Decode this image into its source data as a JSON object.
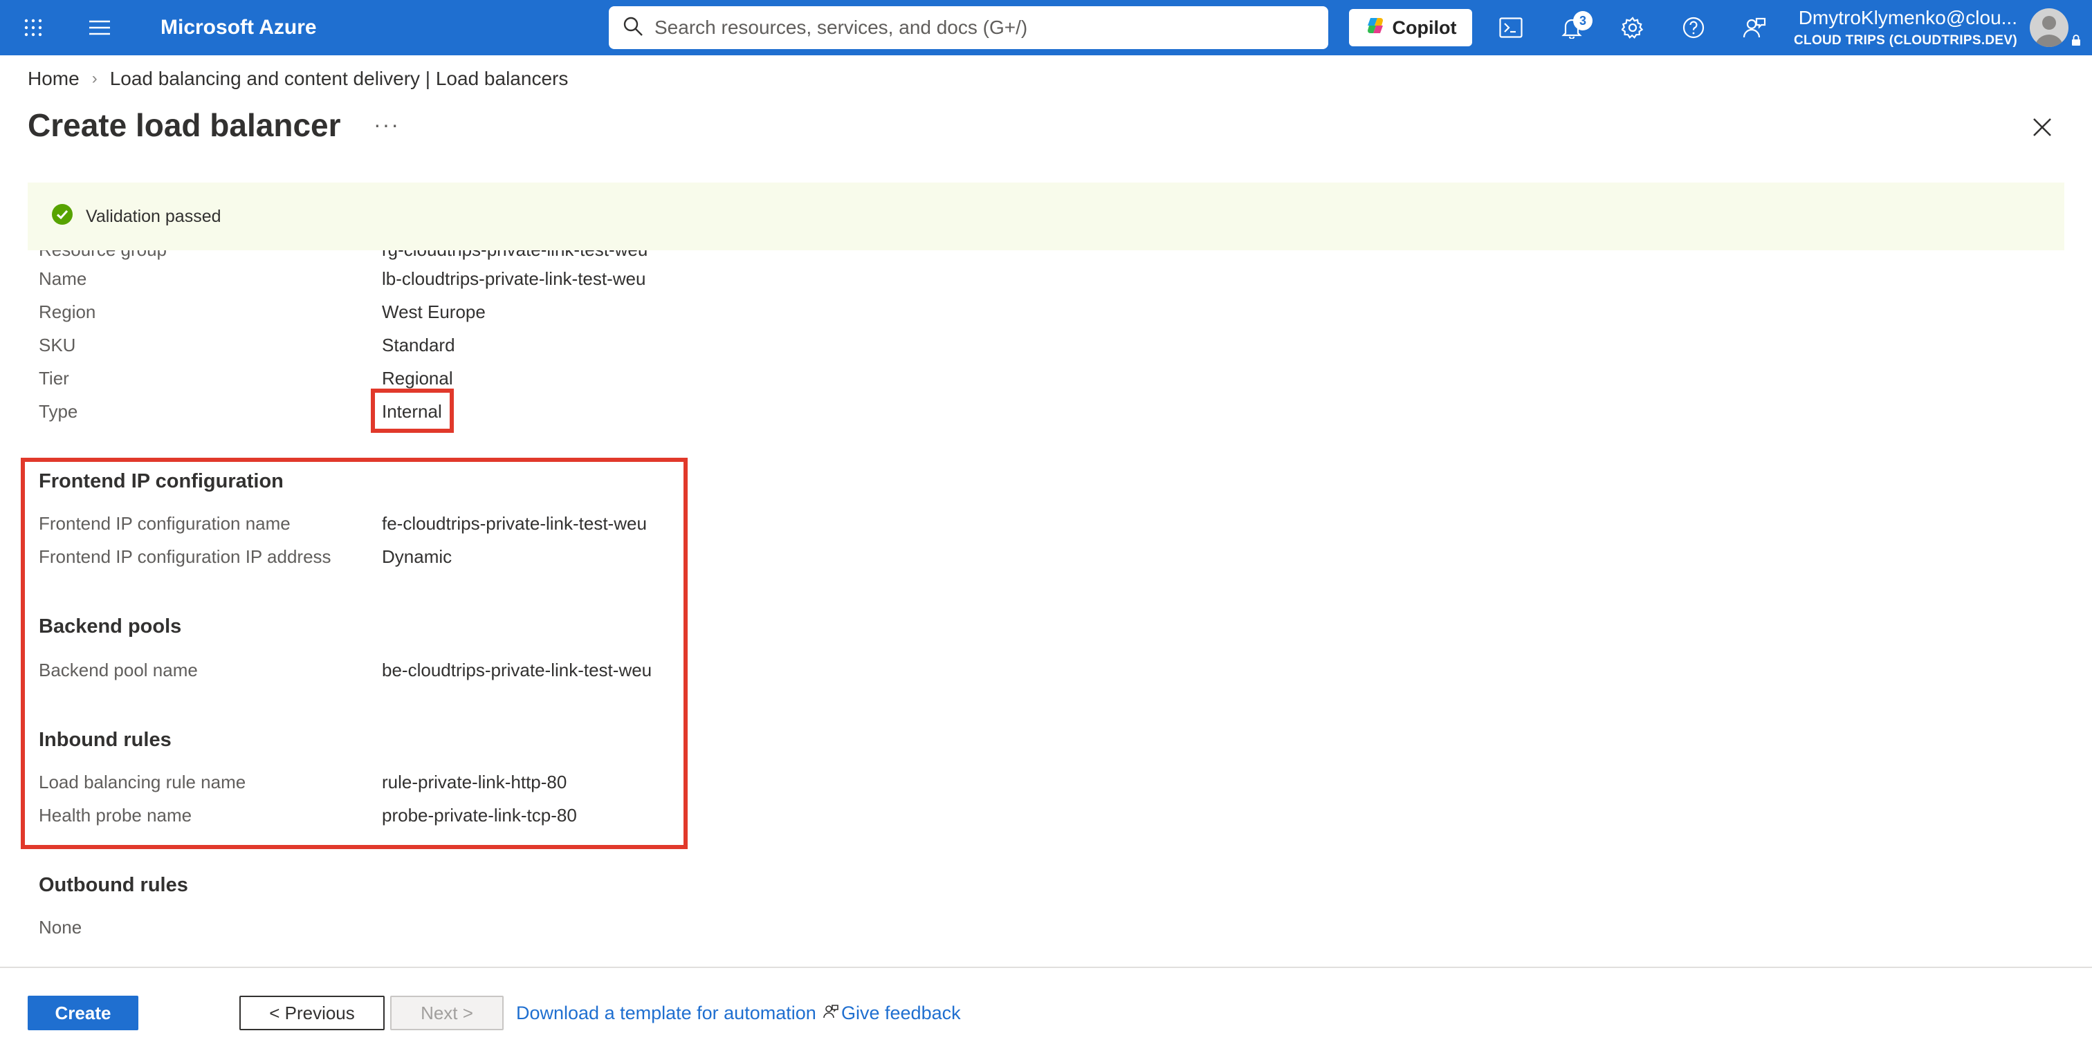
{
  "topbar": {
    "brand": "Microsoft Azure",
    "search_placeholder": "Search resources, services, and docs (G+/)",
    "copilot_label": "Copilot",
    "notification_count": "3",
    "account_name": "DmytroKlymenko@clou...",
    "account_tenant": "CLOUD TRIPS (CLOUDTRIPS.DEV)"
  },
  "breadcrumb": {
    "home": "Home",
    "parent": "Load balancing and content delivery | Load balancers"
  },
  "page": {
    "title": "Create load balancer",
    "more": "···"
  },
  "banner": {
    "message": "Validation passed"
  },
  "basics": {
    "clipped_label": "Resource group",
    "clipped_value": "rg-cloudtrips-private-link-test-weu",
    "rows": [
      {
        "label": "Name",
        "value": "lb-cloudtrips-private-link-test-weu"
      },
      {
        "label": "Region",
        "value": "West Europe"
      },
      {
        "label": "SKU",
        "value": "Standard"
      },
      {
        "label": "Tier",
        "value": "Regional"
      },
      {
        "label": "Type",
        "value": "Internal"
      }
    ]
  },
  "frontend": {
    "title": "Frontend IP configuration",
    "rows": [
      {
        "label": "Frontend IP configuration name",
        "value": "fe-cloudtrips-private-link-test-weu"
      },
      {
        "label": "Frontend IP configuration IP address",
        "value": "Dynamic"
      }
    ]
  },
  "backend": {
    "title": "Backend pools",
    "rows": [
      {
        "label": "Backend pool name",
        "value": "be-cloudtrips-private-link-test-weu"
      }
    ]
  },
  "inbound": {
    "title": "Inbound rules",
    "rows": [
      {
        "label": "Load balancing rule name",
        "value": "rule-private-link-http-80"
      },
      {
        "label": "Health probe name",
        "value": "probe-private-link-tcp-80"
      }
    ]
  },
  "outbound": {
    "title": "Outbound rules",
    "rows": [
      {
        "label": "",
        "value": "None"
      }
    ]
  },
  "footer": {
    "create": "Create",
    "previous": "< Previous",
    "next": "Next >",
    "download_template": "Download a template for automation",
    "feedback": "Give feedback"
  },
  "colors": {
    "azure_blue": "#1f6fd0",
    "highlight_red": "#e1392b",
    "success_green": "#57a300",
    "banner_bg": "#f8fbeb"
  }
}
